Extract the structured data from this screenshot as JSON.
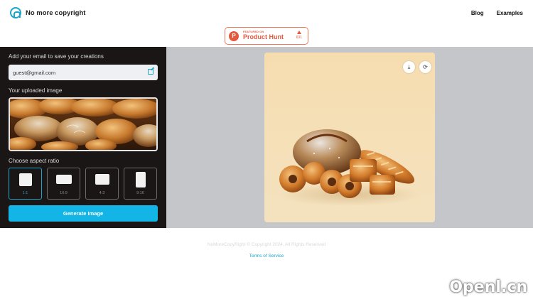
{
  "brand": {
    "name": "No more copyright",
    "logo_icon": "arch-logo-icon",
    "accent": "#1aa6c9"
  },
  "nav": {
    "blog": "Blog",
    "examples": "Examples"
  },
  "product_hunt": {
    "top_line": "FEATURED ON",
    "name": "Product Hunt",
    "votes": "631",
    "color": "#e5583c"
  },
  "form": {
    "email_label": "Add your email to save your creations",
    "email_value": "guest@gmail.com",
    "uploaded_label": "Your uploaded image",
    "aspect_label": "Choose aspect ratio",
    "ratios": [
      {
        "label": "1:1",
        "selected": true
      },
      {
        "label": "16:9",
        "selected": false
      },
      {
        "label": "4:3",
        "selected": false
      },
      {
        "label": "9:16",
        "selected": false
      }
    ],
    "generate_label": "Generate Image",
    "generate_color": "#13b5e6"
  },
  "preview": {
    "download_icon": "download-icon",
    "regenerate_icon": "refresh-icon"
  },
  "footer": {
    "copyright": "NoMoreCopyRight © Copyright 2024, All Rights Reserved",
    "terms": "Terms of Service"
  },
  "watermark": "Openl.cn"
}
